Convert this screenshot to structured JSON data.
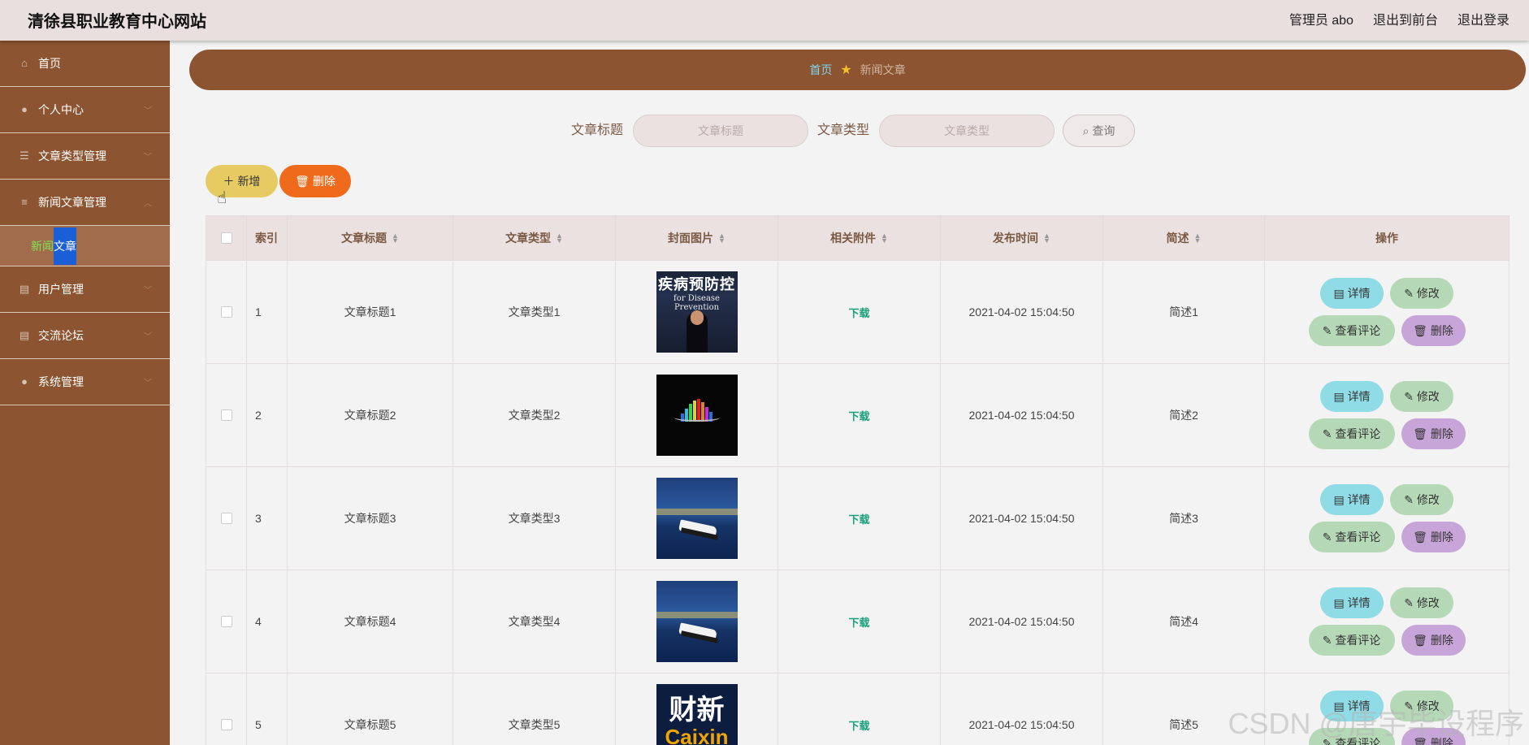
{
  "header": {
    "site_title": "清徐县职业教育中心网站",
    "admin_label": "管理员 abo",
    "back_to_front": "退出到前台",
    "logout": "退出登录"
  },
  "sidebar": {
    "items": [
      {
        "label": "首页",
        "icon": "home-icon"
      },
      {
        "label": "个人中心",
        "icon": "user-icon"
      },
      {
        "label": "文章类型管理",
        "icon": "list-icon"
      },
      {
        "label": "新闻文章管理",
        "icon": "sliders-icon"
      },
      {
        "label": "用户管理",
        "icon": "clipboard-icon"
      },
      {
        "label": "交流论坛",
        "icon": "clipboard-icon"
      },
      {
        "label": "系统管理",
        "icon": "user-icon"
      }
    ],
    "sub_item_part1": "新闻",
    "sub_item_part2": "文章"
  },
  "breadcrumb": {
    "home": "首页",
    "current": "新闻文章"
  },
  "search": {
    "title_label": "文章标题",
    "title_placeholder": "文章标题",
    "type_label": "文章类型",
    "type_placeholder": "文章类型",
    "query_button": "查询"
  },
  "toolbar": {
    "add_label": "新增",
    "delete_label": "删除"
  },
  "table": {
    "columns": [
      "索引",
      "文章标题",
      "文章类型",
      "封面图片",
      "相关附件",
      "发布时间",
      "简述",
      "操作"
    ],
    "rows": [
      {
        "index": "1",
        "title": "文章标题1",
        "type": "文章类型1",
        "attachment": "下载",
        "time": "2021-04-02 15:04:50",
        "desc": "简述1"
      },
      {
        "index": "2",
        "title": "文章标题2",
        "type": "文章类型2",
        "attachment": "下载",
        "time": "2021-04-02 15:04:50",
        "desc": "简述2"
      },
      {
        "index": "3",
        "title": "文章标题3",
        "type": "文章类型3",
        "attachment": "下载",
        "time": "2021-04-02 15:04:50",
        "desc": "简述3"
      },
      {
        "index": "4",
        "title": "文章标题4",
        "type": "文章类型4",
        "attachment": "下载",
        "time": "2021-04-02 15:04:50",
        "desc": "简述4"
      },
      {
        "index": "5",
        "title": "文章标题5",
        "type": "文章类型5",
        "attachment": "下载",
        "time": "2021-04-02 15:04:50",
        "desc": "简述5"
      }
    ],
    "ops": {
      "detail": "详情",
      "edit": "修改",
      "comments": "查看评论",
      "delete": "删除"
    }
  },
  "thumbs": {
    "thumb1_text": "疾病预防控",
    "thumb1_sub": "for Disease Prevention",
    "thumb5_text1": "财新",
    "thumb5_text2": "Caixin"
  },
  "watermark": "CSDN @唐宇毕设程序",
  "colors": {
    "sidebar_bg": "#8c5430",
    "header_bg": "#e9dfdf",
    "add_button": "#e6cb63",
    "delete_button": "#f06a1b",
    "detail_button": "#8fdbe6",
    "edit_button": "#b5d9b7",
    "row_delete_button": "#c7a5d8"
  }
}
